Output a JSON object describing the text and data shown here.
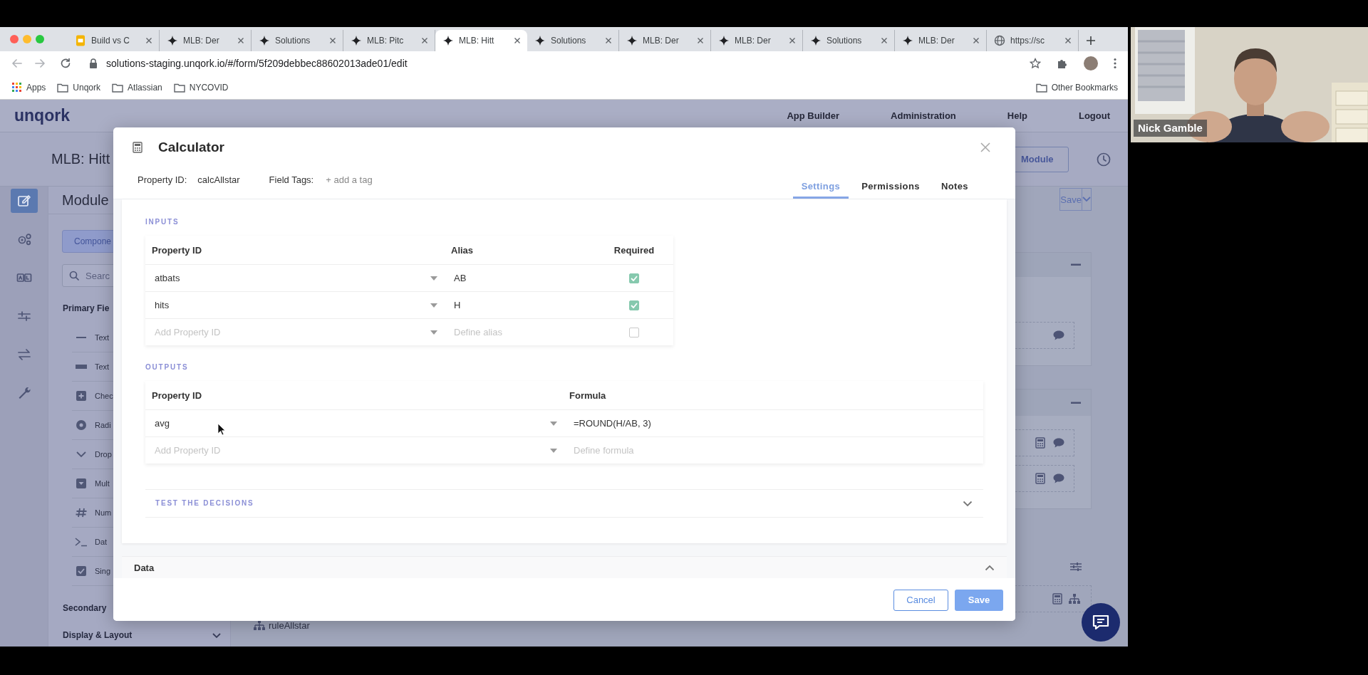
{
  "browser": {
    "tabs": [
      {
        "label": "Build vs C",
        "kind": "slides",
        "selected": false
      },
      {
        "label": "MLB: Der",
        "kind": "app",
        "selected": false
      },
      {
        "label": "Solutions",
        "kind": "app",
        "selected": false
      },
      {
        "label": "MLB: Pitc",
        "kind": "app",
        "selected": false
      },
      {
        "label": "MLB: Hitt",
        "kind": "app",
        "selected": true
      },
      {
        "label": "Solutions",
        "kind": "app",
        "selected": false
      },
      {
        "label": "MLB: Der",
        "kind": "app",
        "selected": false
      },
      {
        "label": "MLB: Der",
        "kind": "app",
        "selected": false
      },
      {
        "label": "Solutions",
        "kind": "app",
        "selected": false
      },
      {
        "label": "MLB: Der",
        "kind": "app",
        "selected": false
      },
      {
        "label": "https://sc",
        "kind": "web",
        "selected": false
      }
    ],
    "address": "solutions-staging.unqork.io/#/form/5f209debbec88602013ade01/edit",
    "bookmarks": [
      {
        "label": "Apps",
        "kind": "apps"
      },
      {
        "label": "Unqork",
        "kind": "folder"
      },
      {
        "label": "Atlassian",
        "kind": "folder"
      },
      {
        "label": "NYCOVID",
        "kind": "folder"
      }
    ],
    "other_bookmarks": "Other Bookmarks"
  },
  "app": {
    "logo": "unqork",
    "nav": [
      "App Builder",
      "Administration",
      "Help",
      "Logout"
    ],
    "page_title": "MLB: Hitt",
    "header_button": "Module",
    "rail": [
      {
        "kind": "edit",
        "selected": true
      },
      {
        "kind": "gears",
        "selected": false
      },
      {
        "kind": "ab",
        "selected": false
      },
      {
        "kind": "sliders",
        "selected": false
      },
      {
        "kind": "arrows",
        "selected": false
      },
      {
        "kind": "wrench",
        "selected": false
      }
    ],
    "panel": {
      "heading": "Module",
      "tab": "Compone",
      "search_placeholder": "Searc",
      "section": "Primary Fie",
      "items": [
        {
          "label": "Text",
          "kind": "line"
        },
        {
          "label": "Text",
          "kind": "bar"
        },
        {
          "label": "Chec",
          "kind": "plus"
        },
        {
          "label": "Radi",
          "kind": "radio"
        },
        {
          "label": "Drop",
          "kind": "chevron"
        },
        {
          "label": "Mult",
          "kind": "select"
        },
        {
          "label": "Num",
          "kind": "number"
        },
        {
          "label": "Dat",
          "kind": "terminal"
        },
        {
          "label": "Sing",
          "kind": "check"
        }
      ],
      "secondary": "Secondary",
      "display_layout": {
        "label": "Display & Layout",
        "expanded": false
      }
    },
    "save_button": "Save",
    "canvas_label": "ruleAllstar"
  },
  "modal": {
    "title": "Calculator",
    "property_id_label": "Property ID:",
    "property_id": "calcAllstar",
    "field_tags_label": "Field Tags:",
    "add_tag": "+ add a tag",
    "tabs": [
      {
        "label": "Settings",
        "selected": true
      },
      {
        "label": "Permissions",
        "selected": false
      },
      {
        "label": "Notes",
        "selected": false
      }
    ],
    "inputs": {
      "label": "INPUTS",
      "columns": [
        "Property ID",
        "Alias",
        "Required"
      ],
      "rows": [
        {
          "property_id": "atbats",
          "alias": "AB",
          "required": true
        },
        {
          "property_id": "hits",
          "alias": "H",
          "required": true
        }
      ],
      "new_row": {
        "property_id_placeholder": "Add Property ID",
        "alias_placeholder": "Define alias",
        "required": false
      }
    },
    "outputs": {
      "label": "OUTPUTS",
      "columns": [
        "Property ID",
        "Formula"
      ],
      "rows": [
        {
          "property_id": "avg",
          "formula": "=ROUND(H/AB, 3)"
        }
      ],
      "new_row": {
        "property_id_placeholder": "Add Property ID",
        "formula_placeholder": "Define formula"
      }
    },
    "test": {
      "label": "TEST THE DECISIONS",
      "expanded": false
    },
    "data": {
      "label": "Data",
      "expanded": true
    },
    "buttons": [
      "Cancel",
      "Save"
    ]
  },
  "webcam": {
    "name": "Nick Gamble"
  }
}
